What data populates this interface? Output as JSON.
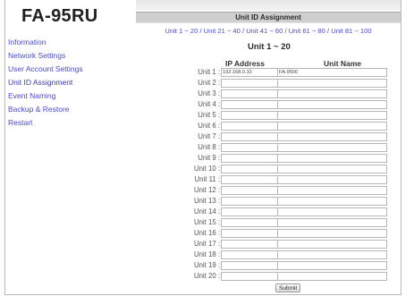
{
  "app": {
    "logo": "FA-95RU"
  },
  "sidebar": {
    "items": [
      {
        "label": "Information"
      },
      {
        "label": "Network Settings"
      },
      {
        "label": "User Account Settings"
      },
      {
        "label": "Unit ID Assignment"
      },
      {
        "label": "Event Naming"
      },
      {
        "label": "Backup & Restore"
      },
      {
        "label": "Restart"
      }
    ]
  },
  "main": {
    "header": "Unit ID Assignment",
    "range_links": [
      "Unit 1 ~ 20",
      "Unit 21 ~ 40",
      "Unit 41 ~ 60",
      "Unit 61 ~ 80",
      "Unit 81 ~ 100"
    ],
    "range_separator": " / ",
    "section_title": "Unit 1 ~ 20",
    "columns": {
      "ip": "IP Address",
      "name": "Unit Name"
    },
    "units": [
      {
        "label": "Unit 1 :",
        "ip": "192.168.0.10",
        "name": "FA-9500"
      },
      {
        "label": "Unit 2 :",
        "ip": "",
        "name": ""
      },
      {
        "label": "Unit 3 :",
        "ip": "",
        "name": ""
      },
      {
        "label": "Unit 4 :",
        "ip": "",
        "name": ""
      },
      {
        "label": "Unit 5 :",
        "ip": "",
        "name": ""
      },
      {
        "label": "Unit 6 :",
        "ip": "",
        "name": ""
      },
      {
        "label": "Unit 7 :",
        "ip": "",
        "name": ""
      },
      {
        "label": "Unit 8 :",
        "ip": "",
        "name": ""
      },
      {
        "label": "Unit 9 :",
        "ip": "",
        "name": ""
      },
      {
        "label": "Unit 10 :",
        "ip": "",
        "name": ""
      },
      {
        "label": "Unit 11 :",
        "ip": "",
        "name": ""
      },
      {
        "label": "Unit 12 :",
        "ip": "",
        "name": ""
      },
      {
        "label": "Unit 13 :",
        "ip": "",
        "name": ""
      },
      {
        "label": "Unit 14 :",
        "ip": "",
        "name": ""
      },
      {
        "label": "Unit 15 :",
        "ip": "",
        "name": ""
      },
      {
        "label": "Unit 16 :",
        "ip": "",
        "name": ""
      },
      {
        "label": "Unit 17 :",
        "ip": "",
        "name": ""
      },
      {
        "label": "Unit 18 :",
        "ip": "",
        "name": ""
      },
      {
        "label": "Unit 19 :",
        "ip": "",
        "name": ""
      },
      {
        "label": "Unit 20 :",
        "ip": "",
        "name": ""
      }
    ],
    "submit_label": "Submit"
  },
  "colors": {
    "link": "#4a4ad0",
    "header_bg": "#cfcfcf",
    "text": "#333333"
  }
}
